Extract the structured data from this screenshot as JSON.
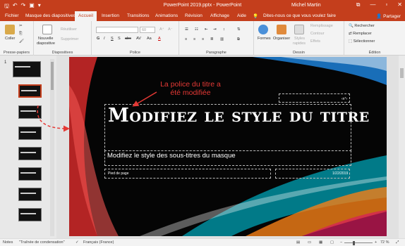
{
  "window": {
    "title": "PowerPoint 2019.pptx - PowerPoint",
    "user": "Michel Martin",
    "controls": [
      "—",
      "▫",
      "✕"
    ],
    "qat_icons": [
      "save-icon",
      "undo-icon",
      "redo-icon",
      "start-slideshow-icon",
      "customize-icon"
    ]
  },
  "tabs": {
    "items": [
      "Fichier",
      "Masque des diapositives",
      "Accueil",
      "Insertion",
      "Transitions",
      "Animations",
      "Révision",
      "Affichage",
      "Aide"
    ],
    "active": "Accueil",
    "tell_me": "Dites-nous ce que vous voulez faire",
    "share": "Partager"
  },
  "ribbon": {
    "clipboard": {
      "paste": "Coller",
      "label": "Presse-papiers"
    },
    "slides": {
      "new_slide_1": "Nouvelle",
      "new_slide_2": "diapositive",
      "reuse": "Réutiliser",
      "delete": "Supprimer",
      "label": "Diapositives"
    },
    "font": {
      "size": "60",
      "label": "Police",
      "bold": "G",
      "italic": "I",
      "underline": "S",
      "shadow": "S",
      "strike": "abc",
      "spacing": "AV",
      "case": "Aa",
      "color": "A"
    },
    "paragraph": {
      "label": "Paragraphe"
    },
    "drawing": {
      "shapes": "Formes",
      "arrange": "Organiser",
      "styles_1": "Styles",
      "styles_2": "rapides",
      "fill": "Remplissage",
      "outline": "Contour",
      "effects": "Effets",
      "label": "Dessin"
    },
    "editing": {
      "find": "Rechercher",
      "replace": "Remplacer",
      "select": "Sélectionner",
      "label": "Édition"
    }
  },
  "thumbnails": {
    "first_number": "1",
    "count": 8,
    "selected_index": 1
  },
  "slide": {
    "title": "Modifiez le style du titre",
    "subtitle": "Modifiez le style des sous-titres du masque",
    "footer": "Pied de page",
    "date": "1/22/2019",
    "number": "‹n°›"
  },
  "annotation": {
    "line1": "La police du titre a",
    "line2": "été modifiée",
    "color": "#e53935"
  },
  "statusbar": {
    "notes": "Notes",
    "theme": "\"Traînée de condensation\"",
    "language": "Français (France)",
    "zoom": "72 %",
    "zoom_fraction": 0.72
  },
  "colors": {
    "accent": "#c43e1c"
  }
}
